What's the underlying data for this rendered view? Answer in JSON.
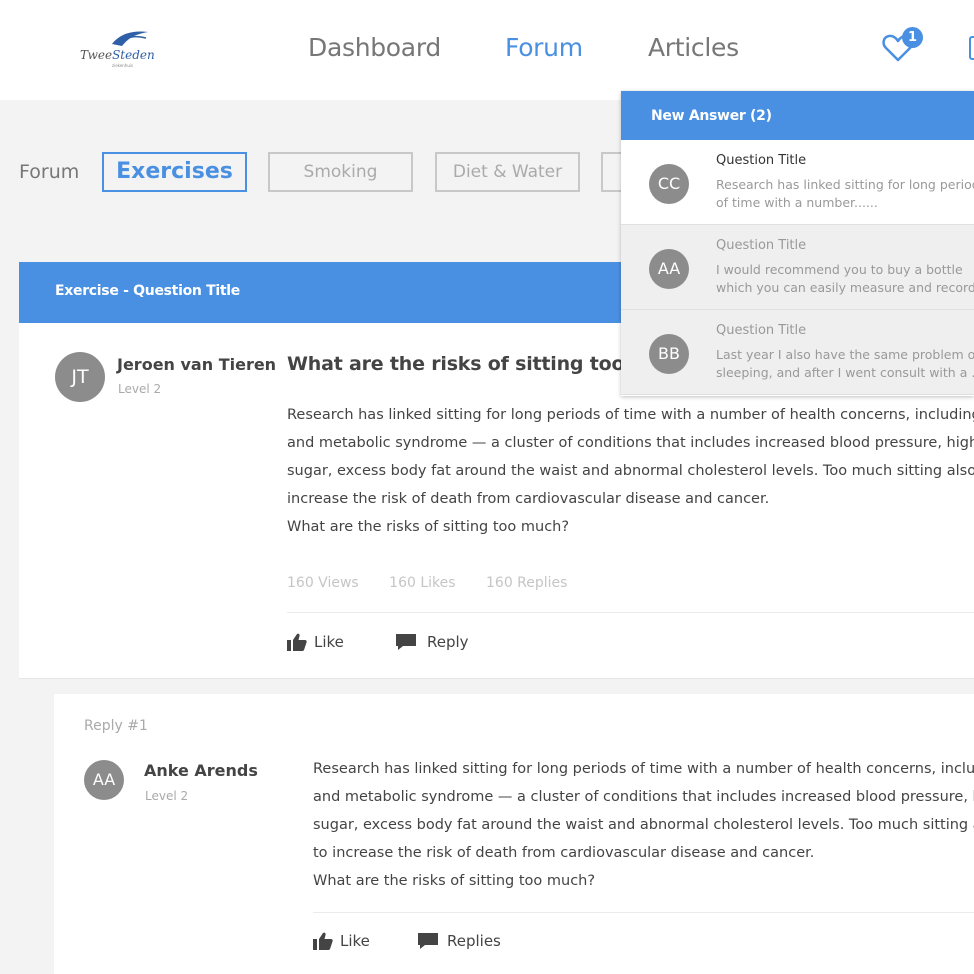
{
  "header": {
    "logo": {
      "word1": "Twee",
      "word2": "Steden",
      "sub": "ziekenhuis"
    },
    "nav": [
      {
        "label": "Dashboard"
      },
      {
        "label": "Forum"
      },
      {
        "label": "Articles"
      }
    ],
    "notification_count": "1"
  },
  "filters": {
    "label": "Forum",
    "tabs": [
      {
        "label": "Exercises",
        "active": true
      },
      {
        "label": "Smoking"
      },
      {
        "label": "Diet & Water"
      }
    ]
  },
  "question": {
    "header_title": "Exercise - Question Title",
    "author": {
      "initials": "JT",
      "name": "Jeroen van Tieren",
      "level": "Level 2"
    },
    "title": "What are the risks of sitting too mu",
    "body": [
      "Research has linked sitting for long periods of time with a number of health concerns, including",
      "and metabolic syndrome — a cluster of conditions that includes increased blood pressure, high",
      "sugar, excess body fat around the waist and abnormal cholesterol levels. Too much sitting also",
      "increase the risk of death from cardiovascular disease and cancer.",
      "What are the risks of sitting too much?"
    ],
    "stats": {
      "views": "160 Views",
      "likes": "160 Likes",
      "replies": "160 Replies"
    },
    "actions": {
      "like": "Like",
      "reply": "Reply"
    }
  },
  "reply": {
    "label": "Reply #1",
    "author": {
      "initials": "AA",
      "name": "Anke Arends",
      "level": "Level 2"
    },
    "body": [
      "Research has linked sitting for long periods of time with a number of health concerns, includin",
      "and metabolic syndrome — a cluster of conditions that includes increased blood pressure, high",
      "sugar, excess body fat around the waist and abnormal cholesterol levels. Too much sitting also",
      "to increase the risk of death from cardiovascular disease and cancer.",
      "What are the risks of sitting too much?"
    ],
    "actions": {
      "like": "Like",
      "replies": "Replies"
    }
  },
  "notifications": {
    "title": "New Answer (2)",
    "items": [
      {
        "initials": "CC",
        "title": "Question Title",
        "text": [
          "Research has linked sitting for long period",
          "of time with a number......"
        ],
        "read": false
      },
      {
        "initials": "AA",
        "title": "Question Title",
        "text": [
          "I would recommend you to buy a bottle",
          "which you can easily measure and record."
        ],
        "read": true
      },
      {
        "initials": "BB",
        "title": "Question Title",
        "text": [
          "Last year I also have the same problem of",
          "sleeping, and after I went consult with a ..."
        ],
        "read": true
      }
    ]
  },
  "colors": {
    "accent": "#4a90e2",
    "avatar": "#8c8c8c",
    "page_bg": "#f3f3f3"
  }
}
